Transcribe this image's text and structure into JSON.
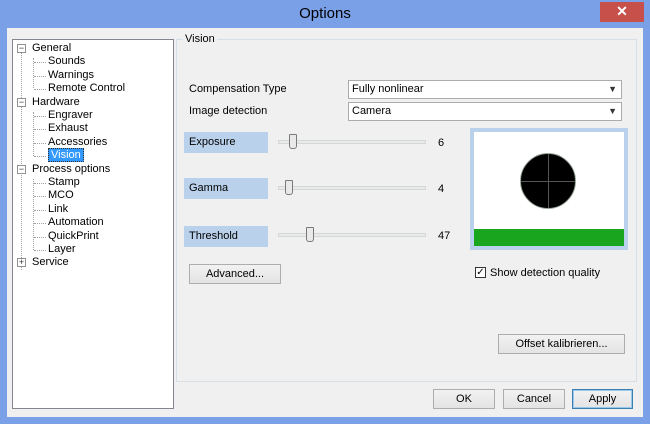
{
  "window": {
    "title": "Options",
    "close_glyph": "✕"
  },
  "tree": {
    "items": [
      {
        "label": "General",
        "level": 0,
        "expander": "−"
      },
      {
        "label": "Sounds",
        "level": 1
      },
      {
        "label": "Warnings",
        "level": 1
      },
      {
        "label": "Remote Control",
        "level": 1
      },
      {
        "label": "Hardware",
        "level": 0,
        "expander": "−"
      },
      {
        "label": "Engraver",
        "level": 1
      },
      {
        "label": "Exhaust",
        "level": 1
      },
      {
        "label": "Accessories",
        "level": 1
      },
      {
        "label": "Vision",
        "level": 1,
        "selected": true
      },
      {
        "label": "Process options",
        "level": 0,
        "expander": "−"
      },
      {
        "label": "Stamp",
        "level": 1
      },
      {
        "label": "MCO",
        "level": 1
      },
      {
        "label": "Link",
        "level": 1
      },
      {
        "label": "Automation",
        "level": 1
      },
      {
        "label": "QuickPrint",
        "level": 1
      },
      {
        "label": "Layer",
        "level": 1
      },
      {
        "label": "Service",
        "level": 0,
        "expander": "+"
      }
    ]
  },
  "vision": {
    "group_label": "Vision",
    "compensation": {
      "label": "Compensation Type",
      "value": "Fully nonlinear"
    },
    "image_detection": {
      "label": "Image detection",
      "value": "Camera"
    },
    "exposure": {
      "label": "Exposure",
      "value": "6",
      "fraction": 0.08
    },
    "gamma": {
      "label": "Gamma",
      "value": "4",
      "fraction": 0.05
    },
    "threshold": {
      "label": "Threshold",
      "value": "47",
      "fraction": 0.2
    },
    "advanced_label": "Advanced...",
    "show_quality": {
      "label": "Show detection quality",
      "checked": true,
      "check_glyph": "✓"
    },
    "offset_label": "Offset kalibrieren...",
    "quality_color": "#19a51e"
  },
  "footer": {
    "ok": "OK",
    "cancel": "Cancel",
    "apply": "Apply"
  },
  "icons": {
    "combo_arrow": "chevron-down-icon",
    "close": "close-icon",
    "checkmark": "checkmark-icon"
  }
}
